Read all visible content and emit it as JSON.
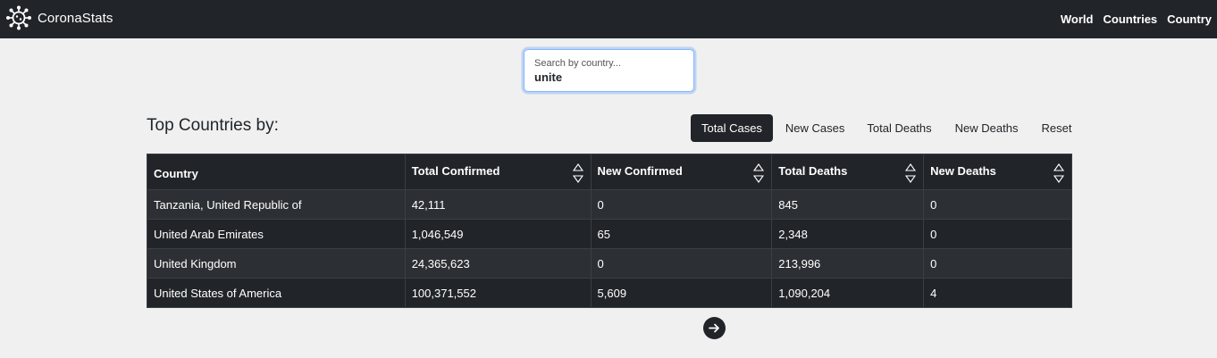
{
  "brand": {
    "name": "CoronaStats",
    "logo_icon": "virus-icon"
  },
  "nav": {
    "links": [
      "World",
      "Countries",
      "Country"
    ]
  },
  "search": {
    "placeholder": "Search by country...",
    "value": "unite"
  },
  "section": {
    "title": "Top Countries by:"
  },
  "sort_tabs": [
    "Total Cases",
    "New Cases",
    "Total Deaths",
    "New Deaths",
    "Reset"
  ],
  "active_tab": "Total Cases",
  "table": {
    "headers": [
      "Country",
      "Total Confirmed",
      "New Confirmed",
      "Total Deaths",
      "New Deaths"
    ],
    "rows": [
      [
        "Tanzania, United Republic of",
        "42,111",
        "0",
        "845",
        "0"
      ],
      [
        "United Arab Emirates",
        "1,046,549",
        "65",
        "2,348",
        "0"
      ],
      [
        "United Kingdom",
        "24,365,623",
        "0",
        "213,996",
        "0"
      ],
      [
        "United States of America",
        "100,371,552",
        "5,609",
        "1,090,204",
        "4"
      ]
    ]
  },
  "pagination": {
    "next_icon": "arrow-right-icon"
  },
  "colors": {
    "dark": "#212529",
    "row_alt": "#2c3034",
    "background": "#f0f0f0",
    "focus": "#86b7fe"
  }
}
